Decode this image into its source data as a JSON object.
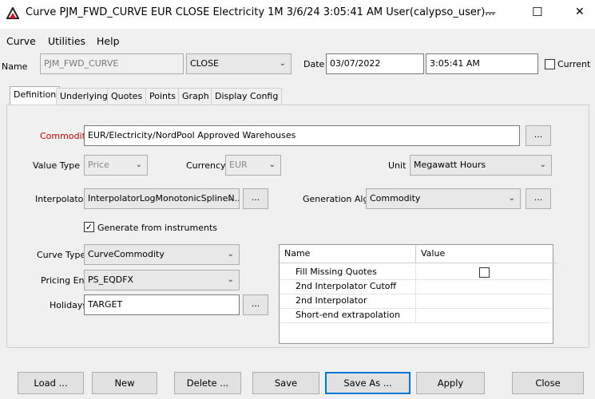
{
  "window": {
    "title": "Curve  PJM_FWD_CURVE EUR CLOSE Electricity 1M 3/6/24 3:05:41 AM User(calypso_user)...",
    "minimize": "—",
    "maximize": "☐",
    "close": "✕"
  },
  "menu": {
    "items": [
      "Curve",
      "Utilities",
      "Help"
    ]
  },
  "header": {
    "name_label": "Name",
    "name_value": "PJM_FWD_CURVE",
    "type_value": "CLOSE",
    "date_label": "Date",
    "date_value": "03/07/2022",
    "time_value": "3:05:41 AM",
    "current_label": "Current",
    "current_checked": false
  },
  "tabs": [
    "Definition",
    "Underlying",
    "Quotes",
    "Points",
    "Graph",
    "Display Config"
  ],
  "definition": {
    "commodity_label": "Commodity",
    "commodity_value": "EUR/Electricity/NordPool Approved Warehouses",
    "value_type_label": "Value Type",
    "value_type_value": "Price",
    "currency_label": "Currency",
    "currency_value": "EUR",
    "unit_label": "Unit",
    "unit_value": "Megawatt Hours",
    "interpolator_label": "Interpolator",
    "interpolator_value": "InterpolatorLogMonotonicSplineN...",
    "generation_label": "Generation Alg.",
    "generation_value": "Commodity",
    "generate_label": "Generate from instruments",
    "generate_checked": true,
    "curve_type_label": "Curve Type",
    "curve_type_value": "CurveCommodity",
    "pricing_env_label": "Pricing Env",
    "pricing_env_value": "PS_EQDFX",
    "holidays_label": "Holidays",
    "holidays_value": "TARGET",
    "ellipsis": "...",
    "colors": {
      "commodity_label": "#cc0000"
    }
  },
  "props_table": {
    "headers": [
      "Name",
      "Value"
    ],
    "rows": [
      {
        "name": "Fill Missing Quotes",
        "value": "checkbox-unchecked"
      },
      {
        "name": "2nd Interpolator Cutoff",
        "value": ""
      },
      {
        "name": "2nd Interpolator",
        "value": ""
      },
      {
        "name": "Short-end extrapolation",
        "value": ""
      }
    ]
  },
  "buttons": {
    "load": "Load ...",
    "new": "New",
    "delete": "Delete ...",
    "save": "Save",
    "save_as": "Save As ...",
    "apply": "Apply",
    "close": "Close"
  }
}
